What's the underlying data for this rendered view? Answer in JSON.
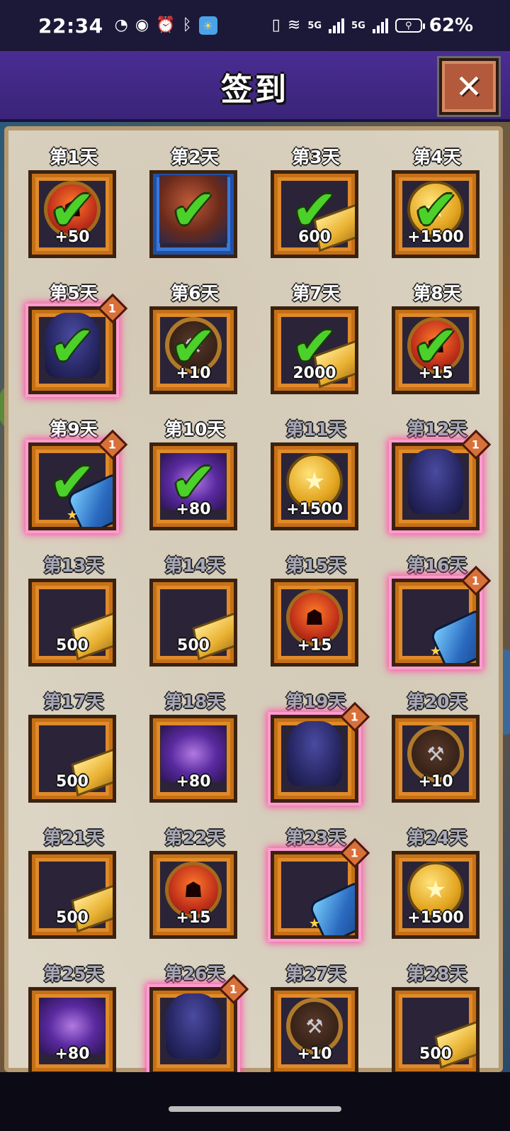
{
  "status_bar": {
    "time": "22:34",
    "left_icons": [
      "notification-icon",
      "eye-icon",
      "alarm-icon",
      "bluetooth-icon",
      "weather-icon"
    ],
    "network_1": "5G",
    "network_2": "5G",
    "battery_percent": "62%"
  },
  "header": {
    "title": "签到",
    "close_glyph": "✕"
  },
  "days": [
    {
      "label": "第1天",
      "item": "red-emblem-coin",
      "count": "+50",
      "claimed": true,
      "badge": "",
      "glow": false
    },
    {
      "label": "第2天",
      "item": "hero-portrait",
      "count": "",
      "claimed": true,
      "badge": "",
      "glow": false,
      "frame": "blue"
    },
    {
      "label": "第3天",
      "item": "gold-bar",
      "count": "600",
      "claimed": true,
      "badge": "",
      "glow": false
    },
    {
      "label": "第4天",
      "item": "gold-star-coin",
      "count": "+1500",
      "claimed": true,
      "badge": "",
      "glow": false
    },
    {
      "label": "第5天",
      "item": "dark-monster",
      "count": "",
      "claimed": true,
      "badge": "1",
      "glow": true
    },
    {
      "label": "第6天",
      "item": "anvil-coin",
      "count": "+10",
      "claimed": true,
      "badge": "",
      "glow": false
    },
    {
      "label": "第7天",
      "item": "gold-bar",
      "count": "2000",
      "claimed": true,
      "badge": "",
      "glow": false
    },
    {
      "label": "第8天",
      "item": "red-emblem-coin",
      "count": "+15",
      "claimed": true,
      "badge": "",
      "glow": false
    },
    {
      "label": "第9天",
      "item": "gauntlet",
      "count": "",
      "claimed": true,
      "badge": "1",
      "glow": true
    },
    {
      "label": "第10天",
      "item": "galaxy",
      "count": "+80",
      "claimed": true,
      "badge": "",
      "glow": false
    },
    {
      "label": "第11天",
      "item": "gold-star-coin",
      "count": "+1500",
      "claimed": false,
      "badge": "",
      "glow": false
    },
    {
      "label": "第12天",
      "item": "dark-monster",
      "count": "",
      "claimed": false,
      "badge": "1",
      "glow": true
    },
    {
      "label": "第13天",
      "item": "gold-bar",
      "count": "500",
      "claimed": false,
      "badge": "",
      "glow": false
    },
    {
      "label": "第14天",
      "item": "gold-bar",
      "count": "500",
      "claimed": false,
      "badge": "",
      "glow": false
    },
    {
      "label": "第15天",
      "item": "red-emblem-coin",
      "count": "+15",
      "claimed": false,
      "badge": "",
      "glow": false
    },
    {
      "label": "第16天",
      "item": "gauntlet",
      "count": "",
      "claimed": false,
      "badge": "1",
      "glow": true
    },
    {
      "label": "第17天",
      "item": "gold-bar",
      "count": "500",
      "claimed": false,
      "badge": "",
      "glow": false
    },
    {
      "label": "第18天",
      "item": "galaxy",
      "count": "+80",
      "claimed": false,
      "badge": "",
      "glow": false
    },
    {
      "label": "第19天",
      "item": "dark-monster",
      "count": "",
      "claimed": false,
      "badge": "1",
      "glow": true
    },
    {
      "label": "第20天",
      "item": "anvil-coin",
      "count": "+10",
      "claimed": false,
      "badge": "",
      "glow": false
    },
    {
      "label": "第21天",
      "item": "gold-bar",
      "count": "500",
      "claimed": false,
      "badge": "",
      "glow": false
    },
    {
      "label": "第22天",
      "item": "red-emblem-coin",
      "count": "+15",
      "claimed": false,
      "badge": "",
      "glow": false
    },
    {
      "label": "第23天",
      "item": "gauntlet",
      "count": "",
      "claimed": false,
      "badge": "1",
      "glow": true
    },
    {
      "label": "第24天",
      "item": "gold-star-coin",
      "count": "+1500",
      "claimed": false,
      "badge": "",
      "glow": false
    },
    {
      "label": "第25天",
      "item": "galaxy",
      "count": "+80",
      "claimed": false,
      "badge": "",
      "glow": false
    },
    {
      "label": "第26天",
      "item": "dark-monster",
      "count": "",
      "claimed": false,
      "badge": "1",
      "glow": true
    },
    {
      "label": "第27天",
      "item": "anvil-coin",
      "count": "+10",
      "claimed": false,
      "badge": "",
      "glow": false
    },
    {
      "label": "第28天",
      "item": "gold-bar",
      "count": "500",
      "claimed": false,
      "badge": "",
      "glow": false
    }
  ],
  "colors": {
    "header_bg": "#4a2d93",
    "frame_orange": "#e08a2a",
    "frame_blue": "#3a78d8",
    "glow_pink": "#ff4fa8",
    "check_green": "#4cd02a",
    "parchment": "#ddd6c6"
  }
}
